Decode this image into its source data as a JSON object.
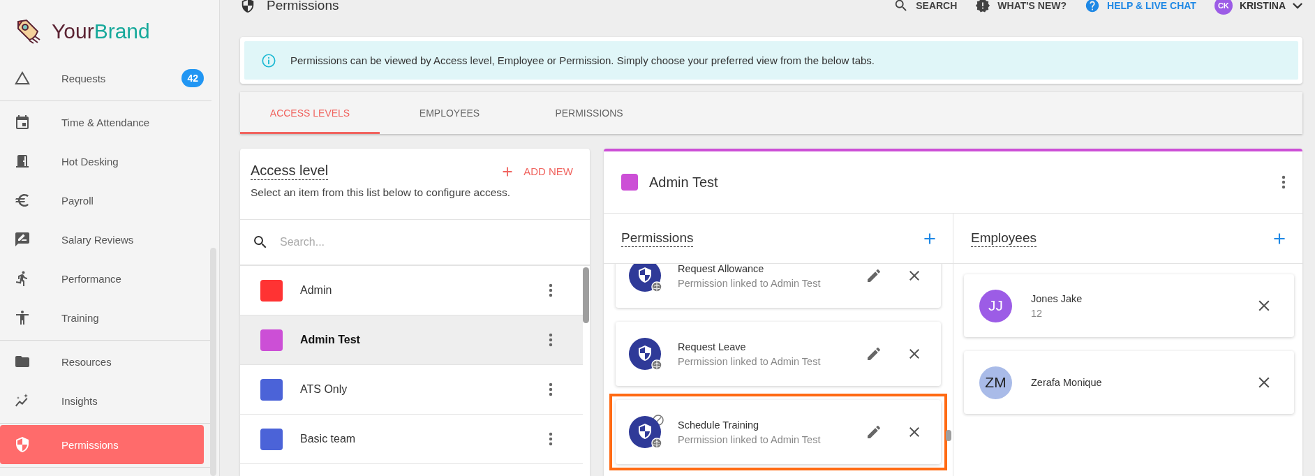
{
  "sidebar": {
    "brand": [
      "Your",
      "Brand"
    ],
    "sections": [
      {
        "items": [
          {
            "label": "Requests",
            "badge": "42",
            "selected": false
          }
        ]
      },
      {
        "items": [
          {
            "label": "Time & Attendance",
            "selected": false
          },
          {
            "label": "Hot Desking",
            "selected": false
          },
          {
            "label": "Payroll",
            "selected": false
          },
          {
            "label": "Salary Reviews",
            "selected": false
          },
          {
            "label": "Performance",
            "selected": false
          },
          {
            "label": "Training",
            "selected": false
          }
        ]
      },
      {
        "items": [
          {
            "label": "Resources",
            "selected": false
          },
          {
            "label": "Insights",
            "selected": false
          }
        ]
      },
      {
        "items": [
          {
            "label": "Permissions",
            "selected": true
          }
        ]
      }
    ]
  },
  "header": {
    "title": "Permissions",
    "actions": [
      {
        "label": "SEARCH",
        "color": "#424242"
      },
      {
        "label": "WHAT'S NEW?",
        "color": "#424242"
      },
      {
        "label": "HELP & LIVE CHAT",
        "color": "#1e88e5"
      }
    ],
    "user": {
      "initials": "CK",
      "name": "KRISTINA"
    }
  },
  "info_banner": "Permissions can be viewed by Access level, Employee or Permission. Simply choose your preferred view from the below tabs.",
  "tabs": [
    {
      "label": "ACCESS LEVELS",
      "selected": true
    },
    {
      "label": "EMPLOYEES",
      "selected": false
    },
    {
      "label": "PERMISSIONS",
      "selected": false
    }
  ],
  "access_panel": {
    "title": "Access level",
    "add_button": "ADD NEW",
    "subtitle": "Select an item from this list below to configure access.",
    "search": {
      "placeholder": "Search..."
    },
    "items": [
      {
        "name": "Admin",
        "color": "#ff3333",
        "selected": false
      },
      {
        "name": "Admin Test",
        "color": "#cc4fd6",
        "selected": true
      },
      {
        "name": "ATS Only",
        "color": "#4b63d8",
        "selected": false
      },
      {
        "name": "Basic team",
        "color": "#4b63d8",
        "selected": false
      }
    ]
  },
  "detail": {
    "name": "Admin Test",
    "color": "#cc4fd6",
    "permissions": {
      "title": "Permissions",
      "items": [
        {
          "name": "Request Allowance",
          "subtitle": "Permission linked to Admin Test",
          "restricted": false,
          "highlighted": false
        },
        {
          "name": "Request Leave",
          "subtitle": "Permission linked to Admin Test",
          "restricted": false,
          "highlighted": false
        },
        {
          "name": "Schedule Training",
          "subtitle": "Permission linked to Admin Test",
          "restricted": true,
          "highlighted": true
        }
      ]
    },
    "employees": {
      "title": "Employees",
      "items": [
        {
          "initials": "JJ",
          "name": "Jones Jake",
          "detail": "12",
          "color": "#9c5ce6"
        },
        {
          "initials": "ZM",
          "name": "Zerafa Monique",
          "color": "#a9bbe8"
        }
      ]
    }
  }
}
